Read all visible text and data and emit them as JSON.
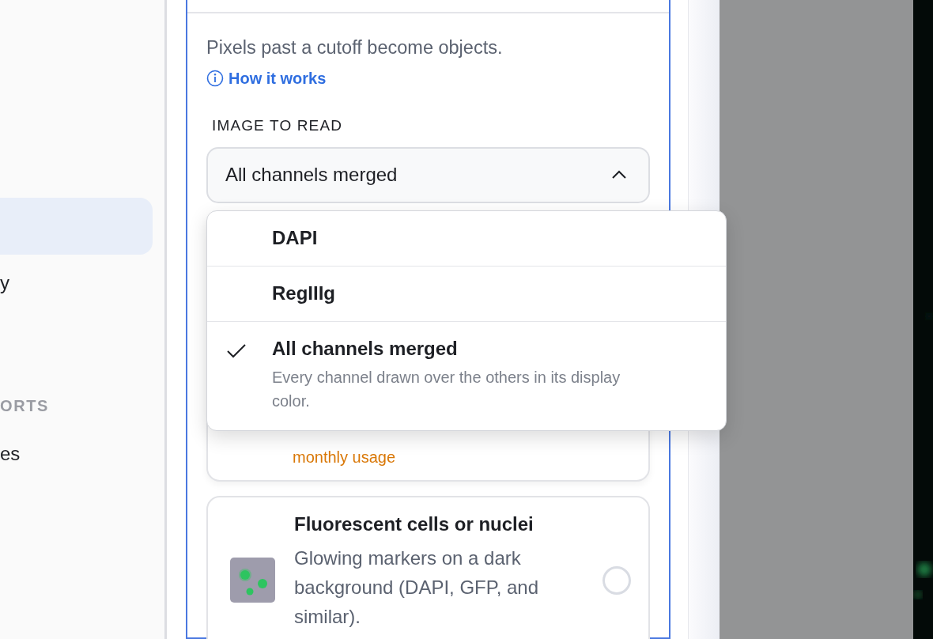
{
  "sidebar": {
    "items": [
      {
        "selected": true
      },
      {
        "label": "y",
        "selected": false
      }
    ],
    "section": {
      "title": "ORTS",
      "items": [
        {
          "label": "es",
          "selected": false
        }
      ]
    }
  },
  "panel": {
    "description": "Pixels past a cutoff become objects.",
    "help_link": "How it works",
    "field_label": "IMAGE TO READ",
    "select": {
      "value": "All channels merged",
      "expanded": true,
      "options": [
        {
          "label": "DAPI",
          "selected": false
        },
        {
          "label": "RegIIIg",
          "selected": false
        },
        {
          "label": "All channels merged",
          "selected": true,
          "description": "Every channel drawn over the others in its display color."
        }
      ]
    },
    "cards": [
      {
        "kind": "partial",
        "note": "monthly usage"
      },
      {
        "kind": "full",
        "title": "Fluorescent cells or nuclei",
        "description": "Glowing markers on a dark background (DAPI, GFP, and similar).",
        "selected": false
      }
    ]
  }
}
